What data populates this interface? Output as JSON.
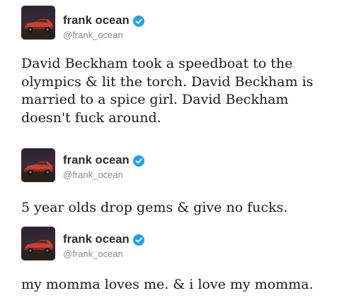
{
  "tweets": [
    {
      "author": {
        "name": "frank ocean",
        "handle": "@frank_ocean",
        "avatar": "car-avatar",
        "verified": true
      },
      "text": "David Beckham took a speedboat to the\nolympics & lit the torch. David Beckham is\nmarried to a spice girl. David Beckham\ndoesn't fuck around."
    },
    {
      "author": {
        "name": "frank ocean",
        "handle": "@frank_ocean",
        "avatar": "car-avatar",
        "verified": true
      },
      "text": "5 year olds drop gems & give no fucks."
    },
    {
      "author": {
        "name": "frank ocean",
        "handle": "@frank_ocean",
        "avatar": "car-avatar",
        "verified": true
      },
      "text": "my momma loves me. & i love my momma."
    }
  ],
  "colors": {
    "verified_badge": "#1da1f2",
    "handle": "#8a8a8a",
    "text": "#1a1a1a"
  }
}
